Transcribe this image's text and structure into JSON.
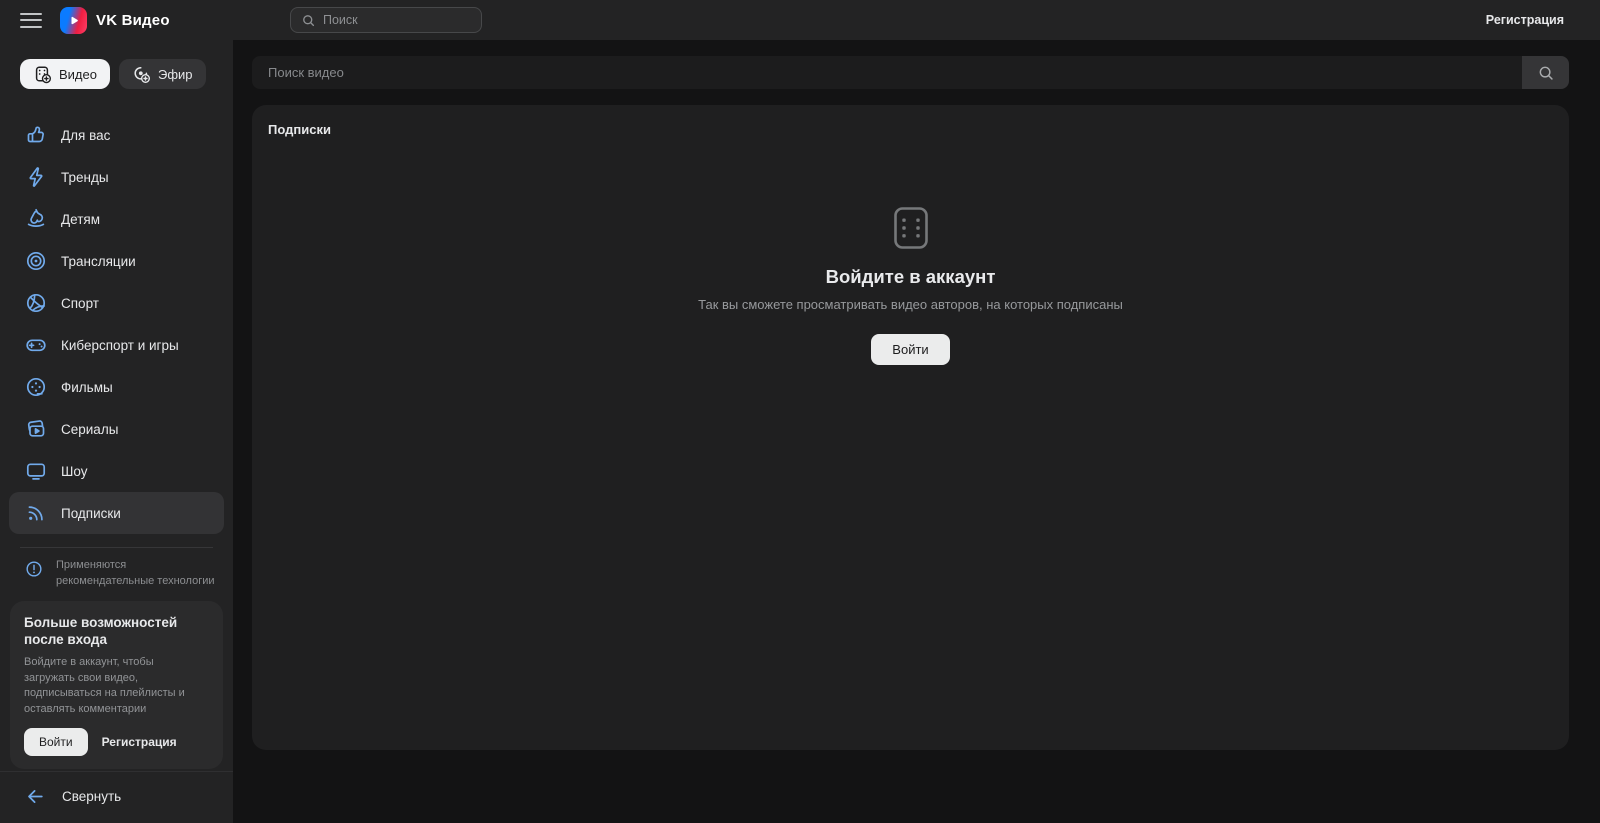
{
  "topbar": {
    "app_title": "VK Видео",
    "search_placeholder": "Поиск",
    "registration_label": "Регистрация"
  },
  "sidebar": {
    "mode_buttons": [
      {
        "label": "Видео",
        "active": true
      },
      {
        "label": "Эфир",
        "active": false
      }
    ],
    "items": [
      {
        "id": "for-you",
        "label": "Для вас",
        "icon": "thumb-up",
        "active": false
      },
      {
        "id": "trends",
        "label": "Тренды",
        "icon": "lightning",
        "active": false
      },
      {
        "id": "kids",
        "label": "Детям",
        "icon": "rocking-horse",
        "active": false
      },
      {
        "id": "streams",
        "label": "Трансляции",
        "icon": "live-target",
        "active": false
      },
      {
        "id": "sport",
        "label": "Спорт",
        "icon": "basketball",
        "active": false
      },
      {
        "id": "esport",
        "label": "Киберспорт и игры",
        "icon": "gamepad",
        "active": false
      },
      {
        "id": "movies",
        "label": "Фильмы",
        "icon": "film-reel",
        "active": false
      },
      {
        "id": "series",
        "label": "Сериалы",
        "icon": "stacked-cards",
        "active": false
      },
      {
        "id": "shows",
        "label": "Шоу",
        "icon": "tv",
        "active": false
      },
      {
        "id": "subscriptions",
        "label": "Подписки",
        "icon": "rss",
        "active": true
      }
    ],
    "recommendation_note": "Применяются рекомендательные технологии",
    "promo": {
      "title": "Больше возможностей после входа",
      "text": "Войдите в аккаунт, чтобы загружать свои видео, подписываться на плейлисты и оставлять комментарии",
      "login_label": "Войти",
      "register_label": "Регистрация"
    },
    "collapse_label": "Свернуть"
  },
  "main": {
    "search_placeholder": "Поиск видео",
    "section_title": "Подписки",
    "empty_state": {
      "title": "Войдите в аккаунт",
      "subtitle": "Так вы сможете просматривать видео авторов, на которых подписаны",
      "login_label": "Войти"
    }
  },
  "colors": {
    "accent_blue": "#71aaeb",
    "logo_blue": "#0b7bff",
    "logo_red": "#ee1e41",
    "surface": "#232324",
    "panel": "#1f1f20",
    "page": "#131314"
  }
}
